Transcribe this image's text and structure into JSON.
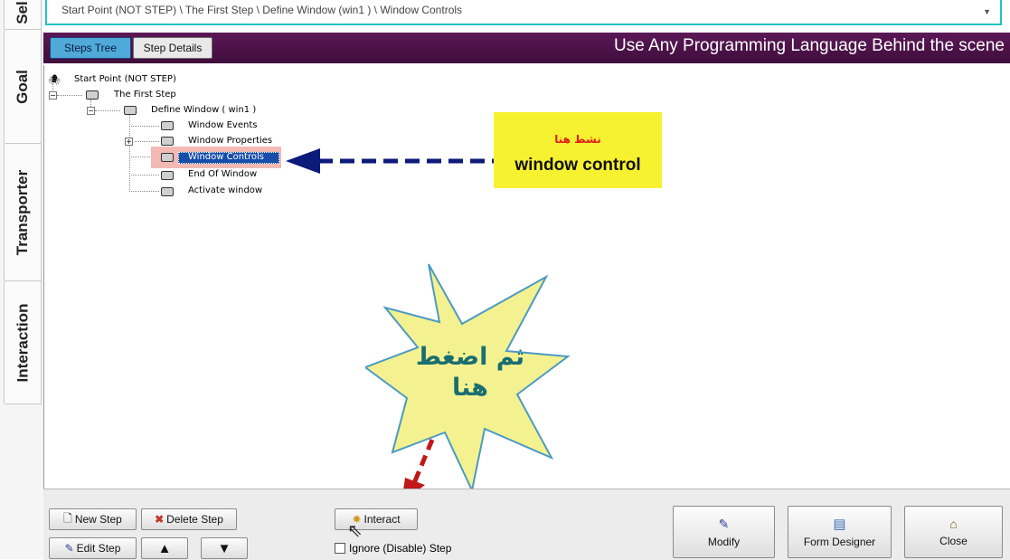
{
  "side_tabs": [
    "Sel",
    "Goal",
    "Transporter",
    "Interaction"
  ],
  "path_bar": "Start Point (NOT STEP) \\ The First Step \\ Define Window  (win1 ) \\ Window Controls",
  "header": {
    "tab_steps_tree": "Steps Tree",
    "tab_step_details": "Step Details",
    "title": "Use Any Programming Language Behind the scene"
  },
  "tree": {
    "root": "Start Point (NOT STEP)",
    "first_step": "The First Step",
    "define_window": "Define Window  ( win1 )",
    "window_events": "Window Events",
    "window_properties": "Window Properties",
    "window_controls": "Window Controls",
    "end_of_window": "End Of Window",
    "activate_window": "Activate window"
  },
  "callouts": {
    "note_arabic": "نشط هنا",
    "note_english": "window control",
    "star_line1": "ثم اضغط",
    "star_line2": "هنا"
  },
  "buttons": {
    "new_step": "New Step",
    "delete_step": "Delete Step",
    "edit_step": "Edit Step",
    "interact": "Interact",
    "ignore_step": "Ignore (Disable) Step",
    "modify": "Modify",
    "form_designer": "Form Designer",
    "close": "Close"
  },
  "colors": {
    "header_bg": "#4a1046",
    "active_tab": "#4fa9d9",
    "path_border": "#1ec5c2",
    "note_bg": "#f7f22f",
    "star_bg": "#f4f290",
    "arrow_blue": "#0c1a7a",
    "arrow_red": "#c01818",
    "selection": "#174daa"
  },
  "icons": [
    "spider-icon",
    "step-icon",
    "new-page-icon",
    "delete-icon",
    "edit-icon",
    "up-arrow-icon",
    "down-arrow-icon",
    "interact-icon",
    "modify-icon",
    "form-designer-icon",
    "close-icon",
    "cursor-icon"
  ]
}
